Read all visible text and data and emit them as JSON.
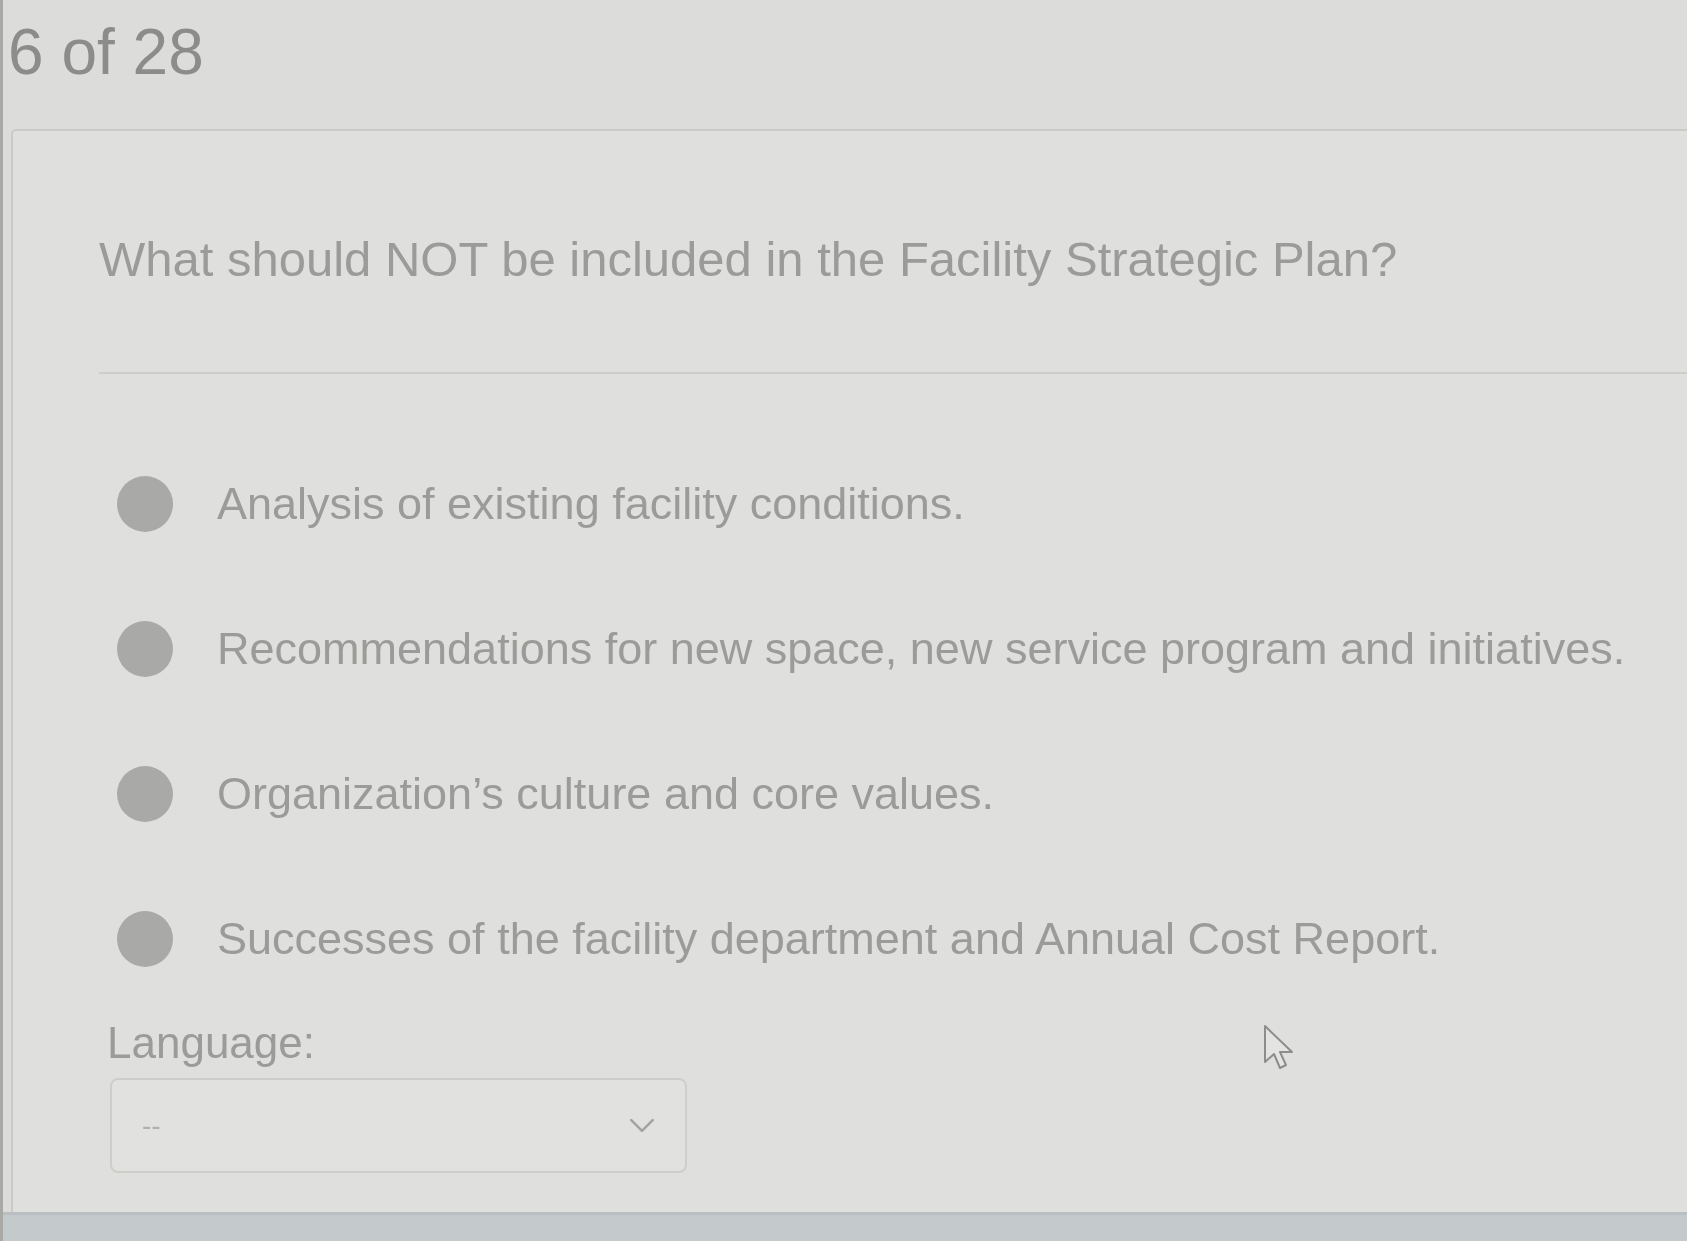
{
  "progress": "6 of 28",
  "question": {
    "text": "What should NOT be included in the Facility Strategic Plan?"
  },
  "options": [
    {
      "label": "Analysis of existing facility conditions.",
      "selected": false
    },
    {
      "label": "Recommendations for new space, new service program and initiatives.",
      "selected": false
    },
    {
      "label": "Organization’s culture and core values.",
      "selected": false
    },
    {
      "label": "Successes of the facility department and Annual Cost Report.",
      "selected": false
    }
  ],
  "language": {
    "label": "Language:",
    "select": {
      "value": "--"
    }
  }
}
